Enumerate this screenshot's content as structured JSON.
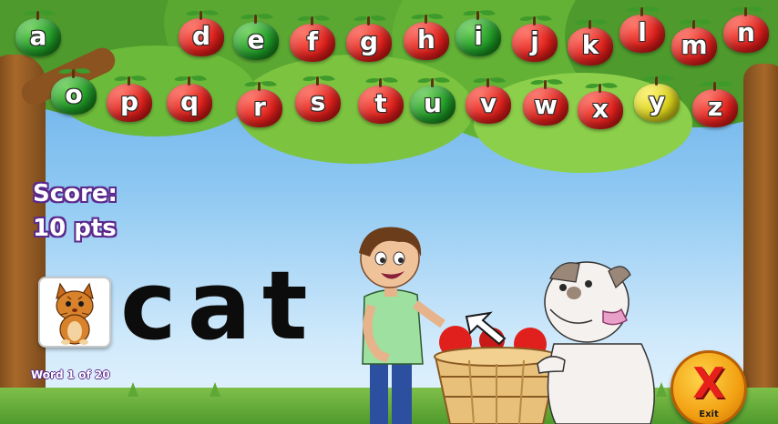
{
  "letters_row1": [
    {
      "letter": "a",
      "color": "green"
    },
    {
      "letter": "d",
      "color": "red"
    },
    {
      "letter": "e",
      "color": "green"
    },
    {
      "letter": "f",
      "color": "red"
    },
    {
      "letter": "g",
      "color": "red"
    },
    {
      "letter": "h",
      "color": "red"
    },
    {
      "letter": "i",
      "color": "green"
    },
    {
      "letter": "j",
      "color": "red"
    },
    {
      "letter": "k",
      "color": "red"
    },
    {
      "letter": "l",
      "color": "red"
    },
    {
      "letter": "m",
      "color": "red"
    },
    {
      "letter": "n",
      "color": "red"
    }
  ],
  "letters_row2": [
    {
      "letter": "o",
      "color": "green"
    },
    {
      "letter": "p",
      "color": "red"
    },
    {
      "letter": "q",
      "color": "red"
    },
    {
      "letter": "r",
      "color": "red"
    },
    {
      "letter": "s",
      "color": "red"
    },
    {
      "letter": "t",
      "color": "red"
    },
    {
      "letter": "u",
      "color": "green"
    },
    {
      "letter": "v",
      "color": "red"
    },
    {
      "letter": "w",
      "color": "red"
    },
    {
      "letter": "x",
      "color": "red"
    },
    {
      "letter": "y",
      "color": "yellow"
    },
    {
      "letter": "z",
      "color": "red"
    }
  ],
  "score": {
    "label": "Score:",
    "value": "10 pts"
  },
  "word": {
    "text": "cat",
    "picture_icon": "cat-icon"
  },
  "progress": "Word 1 of 20",
  "exit": {
    "label": "Exit",
    "glyph": "X"
  },
  "colors": {
    "apple_red": "#e0201c",
    "apple_green": "#1f9a26",
    "apple_yellow": "#d9d11a",
    "score_outline": "#5b2a8c",
    "exit_button": "#f2a012"
  }
}
